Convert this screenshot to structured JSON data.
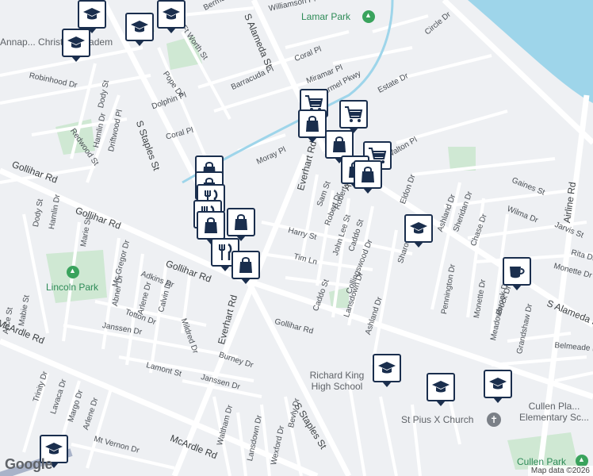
{
  "map": {
    "colors": {
      "background": "#eef0f3",
      "road": "#ffffff",
      "park": "#cfe8d3",
      "water": "#9ed5ea",
      "pin_border": "#1a2e4d"
    },
    "street_labels": [
      "Bermuda Pl",
      "Williamson Pl",
      "S Alameda St",
      "Ft Worth St",
      "Pope Dr",
      "Barracuda Pl",
      "Coral Pl",
      "Miramar Pl",
      "Carmel Pkwy",
      "Estate Dr",
      "Robinhood Dr",
      "Dody St",
      "Hamlin Dr",
      "Driftwood Pl",
      "Redwood St",
      "Dolphin Pl",
      "S Staples St",
      "Coral Pl",
      "Moray Pl",
      "Everhart Rd",
      "Avalon St",
      "Walton Pl",
      "Eldon Dr",
      "Gaines St",
      "Wilma Dr",
      "Jarvis St",
      "Chase Dr",
      "Sheridan Dr",
      "Ashland Dr",
      "Robert Dr",
      "Circle Dr",
      "Airline Rd",
      "Gollihar Rd",
      "Sam St",
      "Robert Dr",
      "John Lee St",
      "Caddo St",
      "Harry St",
      "Tim Ln",
      "Collingswood Dr",
      "Lansdown Dr",
      "Sharon Dr",
      "Pennington Dr",
      "Monette Dr",
      "Meadowbrook Dr",
      "Brock Dr",
      "Monette Dr",
      "Rita Dr",
      "S Alameda St",
      "Belmeade Dr",
      "Dody St",
      "Hamlin Dr",
      "Marie St",
      "Mc Gregor Dr",
      "Adkins Dr",
      "Abner Dr",
      "Arlene Dr",
      "Calvin Dr",
      "Totton Dr",
      "Mildred Dr",
      "Janssen Dr",
      "Everhart Rd",
      "Burney Dr",
      "Gollihar Rd",
      "Caddo St",
      "Ashland Dr",
      "Lamont St",
      "Janssen Dr",
      "S Staples St",
      "Trinity Dr",
      "Lavaca Dr",
      "Margo Dr",
      "Arlene Dr",
      "Mt Vernon Dr",
      "McArdle Rd",
      "Waltham Dr",
      "Lansdown Dr",
      "Wexford Dr",
      "Bevly Dr",
      "Alice St",
      "Mabie St",
      "McArdle Rd",
      "Grandshaw Dr",
      "Gollihar Rd"
    ],
    "places": {
      "lamar_park": "Lamar Park",
      "lincoln_park": "Lincoln Park",
      "cullen_park": "Cullen Park",
      "annapolis": "Annap... Christian Academ",
      "richard_king": "Richard King High School",
      "st_pius": "St Pius X Church",
      "cullen_place": "Cullen Pla... Elementary Sc..."
    },
    "pins": [
      {
        "type": "school"
      },
      {
        "type": "school"
      },
      {
        "type": "school"
      },
      {
        "type": "school"
      },
      {
        "type": "shopping"
      },
      {
        "type": "shopping"
      },
      {
        "type": "restaurant"
      },
      {
        "type": "restaurant"
      },
      {
        "type": "shopping"
      },
      {
        "type": "shopping"
      },
      {
        "type": "restaurant"
      },
      {
        "type": "shopping"
      },
      {
        "type": "cart"
      },
      {
        "type": "cart"
      },
      {
        "type": "shopping"
      },
      {
        "type": "shopping"
      },
      {
        "type": "cart"
      },
      {
        "type": "shopping"
      },
      {
        "type": "shopping"
      },
      {
        "type": "school"
      },
      {
        "type": "cafe"
      },
      {
        "type": "school"
      },
      {
        "type": "school"
      },
      {
        "type": "school"
      },
      {
        "type": "school"
      }
    ],
    "google_logo": "Google",
    "attribution": "Map data ©2026"
  }
}
